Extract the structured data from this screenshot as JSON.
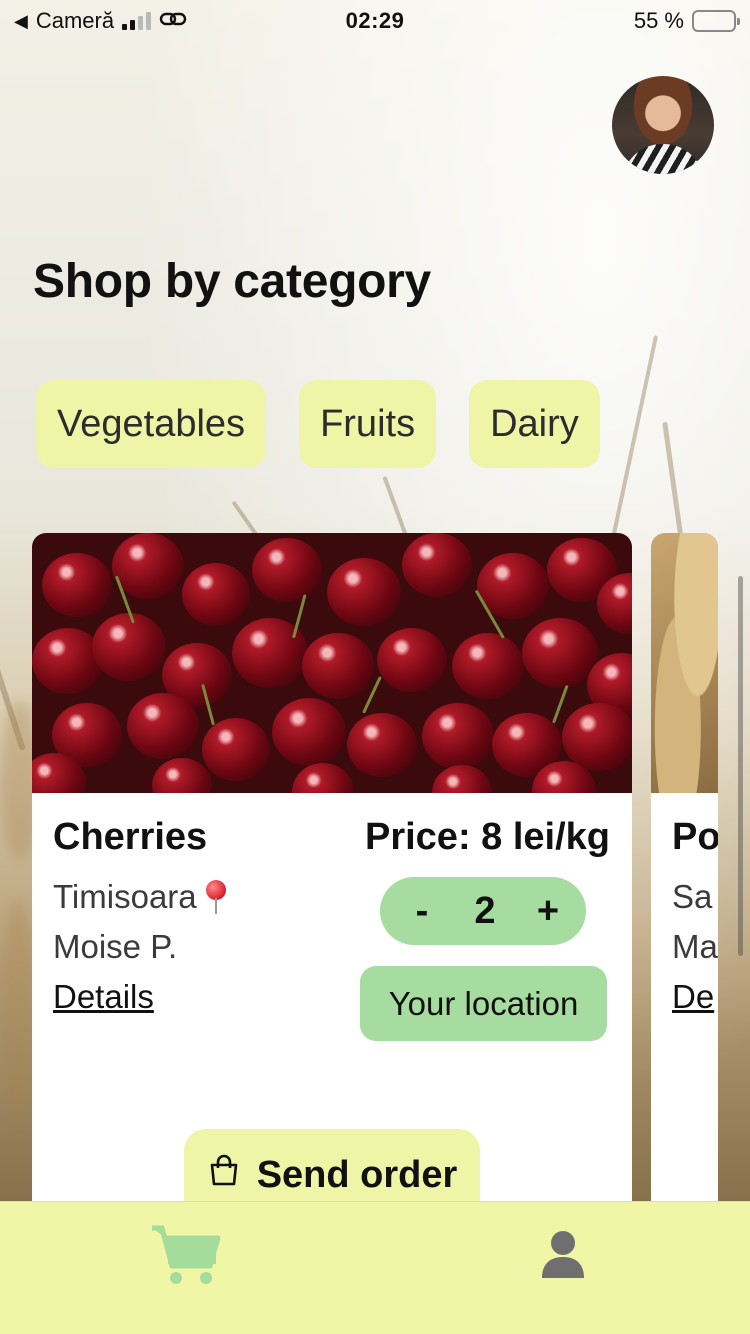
{
  "status_bar": {
    "back_label": "Cameră",
    "time": "02:29",
    "battery_text": "55 %",
    "battery_level": 0.55
  },
  "header": {
    "title": "Shop by category"
  },
  "categories": [
    {
      "label": "Vegetables"
    },
    {
      "label": "Fruits"
    },
    {
      "label": "Dairy"
    }
  ],
  "products": [
    {
      "name": "Cherries",
      "price": "Price: 8 lei/kg",
      "city": "Timisoara",
      "seller": "Moise P.",
      "details_label": "Details",
      "quantity": "2",
      "decrement_label": "-",
      "increment_label": "+",
      "location_label": "Your location",
      "send_label": "Send order"
    },
    {
      "name": "Po",
      "city": "Sa",
      "seller": "Ma",
      "details_label": "De"
    }
  ],
  "nav": {
    "items": [
      {
        "icon": "cart-icon",
        "active": true
      },
      {
        "icon": "user-icon",
        "active": false
      }
    ]
  },
  "colors": {
    "chip_bg": "#eef5a6",
    "accent_green": "#a7dca0",
    "nav_bg": "#f1f5a6",
    "cart_active": "#a4dd9b",
    "user_inactive": "#6f6f6f"
  }
}
